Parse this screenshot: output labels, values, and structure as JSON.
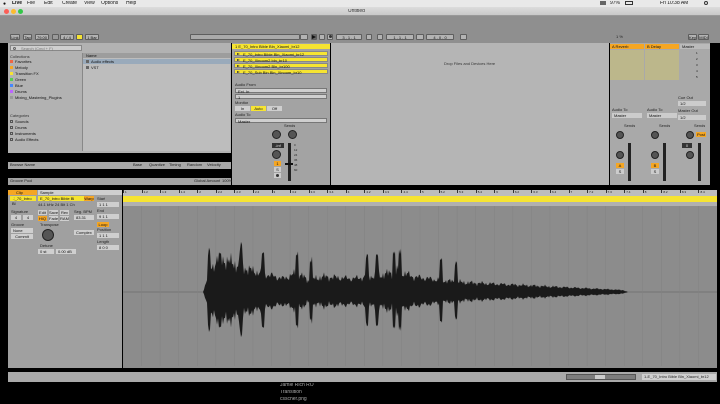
{
  "menubar": {
    "app": "Live",
    "items": [
      "File",
      "Edit",
      "Create",
      "View",
      "Options",
      "Help"
    ],
    "clock": "Fri 10:38 AM",
    "battery": "97%"
  },
  "window": {
    "title": "Untitled"
  },
  "control": {
    "link": "Link",
    "tap": "Tap",
    "tempo": "79.00",
    "signature": "4 / 4",
    "metro": "1 Bar",
    "position": "3 . 1 . 1",
    "loop_start": "1 . 1 . 1",
    "loop_length": "4 . 0 . 0",
    "key": "Key",
    "midi": "MIDI",
    "cpu": "1 %"
  },
  "browser": {
    "search_placeholder": "Search (Cmd + F)",
    "collections_label": "Collections",
    "collections": [
      "Favorites",
      "Melody",
      "Transition FX",
      "Green",
      "Blue",
      "Drums",
      "Mixing_Mastering_Plugins"
    ],
    "categories_label": "Categories",
    "categories": [
      "Sounds",
      "Drums",
      "Instruments",
      "Audio Effects"
    ],
    "column_header": "Name",
    "files": [
      "Audio effects",
      "VST"
    ],
    "browse_name": "Browse Name",
    "groove_cols": [
      "Base",
      "Quantize",
      "Timing",
      "Random",
      "Velocity"
    ],
    "groove_pool": "Groove Pool",
    "global_amount_label": "Global Amount",
    "global_amount": "100%"
  },
  "session": {
    "track_name": "1 E_70_Intro Bible Bln_Xiaomi_br12",
    "clips": [
      "E_70_Intro Bible Bln_Xiaomi_br12",
      "E_70_Xinoom2 bln_br10",
      "E_70_Xinoom2 Bln_br100",
      "E_70_Sub Bin Bln_Xinoom_br10"
    ],
    "drop_message": "Drop Files and Devices Here",
    "audio_from_label": "Audio From",
    "audio_from_value": "Ext. In",
    "audio_from_sub": "1",
    "monitor_label": "Monitor",
    "monitor_opts": [
      "In",
      "Auto",
      "Off"
    ],
    "audio_to_label": "Audio To",
    "audio_to_value": "Master",
    "sends_label": "Sends",
    "vol_value": "-inf",
    "db_scale": [
      "0",
      "12",
      "24",
      "36",
      "48",
      "60"
    ],
    "track_number": "1",
    "s_label": "S"
  },
  "returns": [
    {
      "name": "A Reverb",
      "letter": "A",
      "audio_to_label": "Audio To",
      "audio_to": "Master"
    },
    {
      "name": "B Delay",
      "letter": "B",
      "audio_to_label": "Audio To",
      "audio_to": "Master"
    }
  ],
  "master": {
    "name": "Master",
    "scene_numbers": [
      "1",
      "2",
      "3",
      "4",
      "5",
      "6"
    ],
    "cue_out_label": "Cue Out",
    "cue_out": "1/2",
    "master_out_label": "Master Out",
    "master_out": "1/2",
    "sends_label": "Sends",
    "vol_value": "0",
    "post_label": "Post"
  },
  "clip": {
    "panel_label": "Clip",
    "clip_name": "E_70_Intro Bl",
    "sample_label": "Sample",
    "sample_name": "E_70_Intro Bible Bl",
    "sample_info": "44.1 kHz 24 Bit 1 Ch",
    "edit_label": "Edit",
    "save_label": "Save",
    "rev_label": "Rev",
    "hiq_label": "HiQ",
    "fade_label": "Fade",
    "ram_label": "RAM",
    "signature_label": "Signature",
    "sig_num": "4",
    "sig_den": "4",
    "groove_label": "Groove",
    "groove_value": "None",
    "commit_label": "Commit",
    "transpose_label": "Transpose",
    "transpose_value": "0 st",
    "gain_label": "Detune",
    "gain_value": "0.00 dB",
    "warp_label": "Warp",
    "seg_bpm_label": "Seg. BPM",
    "seg_bpm": "83.31",
    "complex_label": "Complex",
    "start_label": "Start",
    "start_value": "1  1  1",
    "end_label": "End",
    "end_value": "9  1  1",
    "loop_label": "Loop",
    "position_label": "Position",
    "position_value": "1  1  1",
    "length_label": "Length",
    "length_value": "8  0  0",
    "ruler_marks": [
      "1",
      "1.2",
      "1.3",
      "1.4",
      "2",
      "2.2",
      "2.3",
      "2.4",
      "3",
      "3.2",
      "3.3",
      "3.4",
      "4",
      "4.2",
      "4.3",
      "4.4",
      "5",
      "5.2",
      "5.3",
      "5.4",
      "6",
      "6.2",
      "6.3",
      "6.4",
      "7",
      "7.2",
      "7.3",
      "7.4",
      "8",
      "8.2",
      "8.3",
      "8.4"
    ]
  },
  "statusbar": {
    "track_label": "1-E_70_Intro Bible Bln_Xiaomi_br12"
  },
  "finder_peek": [
    "Jamie Rich RO",
    "Transition",
    "csscher.png"
  ],
  "colors": {
    "accent_yellow": "#f6e432",
    "accent_orange": "#f5a623",
    "panel_gray": "#b9b9b9",
    "dark_gray": "#4a4a4a"
  }
}
